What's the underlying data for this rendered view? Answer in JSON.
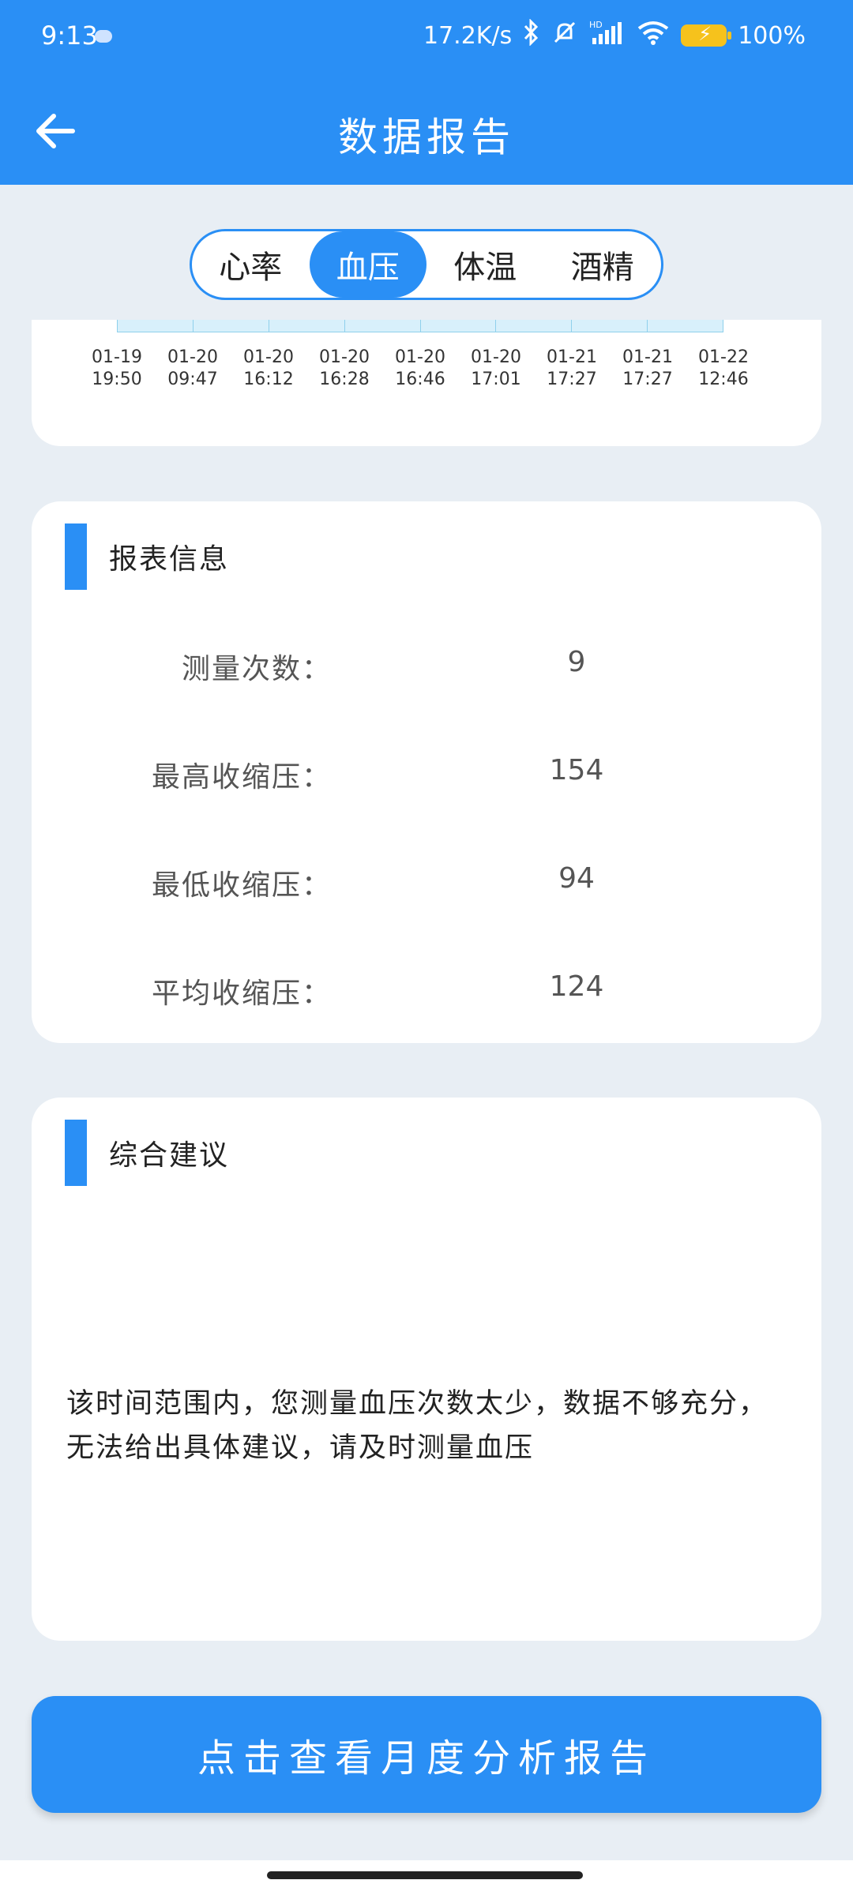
{
  "status_bar": {
    "time": "9:13",
    "network_speed": "17.2K/s",
    "battery": "100%",
    "icons": [
      "bluetooth-icon",
      "mute-icon",
      "hd-signal-icon",
      "wifi-icon",
      "battery-icon"
    ]
  },
  "app_bar": {
    "title": "数据报告",
    "back_icon": "arrow-left-icon"
  },
  "tabs": [
    {
      "label": "心率",
      "active": false
    },
    {
      "label": "血压",
      "active": true
    },
    {
      "label": "体温",
      "active": false
    },
    {
      "label": "酒精",
      "active": false
    }
  ],
  "chart": {
    "x_labels": [
      "01-19\n19:50",
      "01-20\n09:47",
      "01-20\n16:12",
      "01-20\n16:28",
      "01-20\n16:46",
      "01-20\n17:01",
      "01-21\n17:27",
      "01-21\n17:27",
      "01-22\n12:46"
    ]
  },
  "report_info": {
    "title": "报表信息",
    "rows": [
      {
        "label": "测量次数：",
        "value": "9"
      },
      {
        "label": "最高收缩压：",
        "value": "154"
      },
      {
        "label": "最低收缩压：",
        "value": "94"
      },
      {
        "label": "平均收缩压：",
        "value": "124"
      }
    ]
  },
  "advice": {
    "title": "综合建议",
    "text": "该时间范围内，您测量血压次数太少，数据不够充分，无法给出具体建议，请及时测量血压"
  },
  "cta": {
    "label": "点击查看月度分析报告"
  },
  "colors": {
    "primary": "#2a8ff5",
    "background": "#e8eef4",
    "chart_fill": "#d8f0fb"
  }
}
